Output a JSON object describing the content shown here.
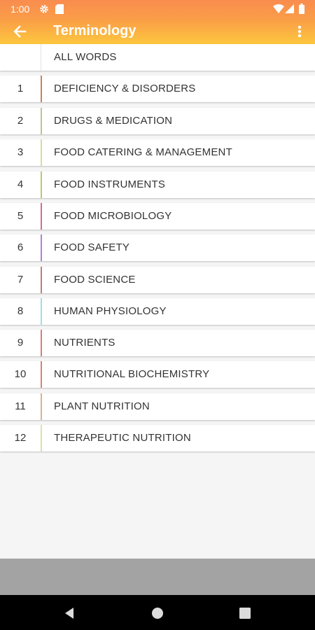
{
  "status_bar": {
    "time": "1:00",
    "icons": [
      "settings-icon",
      "sd-card-icon",
      "wifi-icon",
      "signal-icon",
      "battery-icon"
    ]
  },
  "toolbar": {
    "title": "Terminology",
    "back_icon": "arrow-back-icon",
    "menu_icon": "more-vert-icon"
  },
  "list": {
    "header_label": "ALL WORDS",
    "items": [
      {
        "num": "1",
        "label": "DEFICIENCY & DISORDERS",
        "color": "#c9825a"
      },
      {
        "num": "2",
        "label": "DRUGS & MEDICATION",
        "color": "#b5c98a"
      },
      {
        "num": "3",
        "label": "FOOD CATERING & MANAGEMENT",
        "color": "#d6dc9a"
      },
      {
        "num": "4",
        "label": "FOOD INSTRUMENTS",
        "color": "#b9c86b"
      },
      {
        "num": "5",
        "label": "FOOD MICROBIOLOGY",
        "color": "#d96a85"
      },
      {
        "num": "6",
        "label": "FOOD SAFETY",
        "color": "#b07fd6"
      },
      {
        "num": "7",
        "label": "FOOD SCIENCE",
        "color": "#c57a7a"
      },
      {
        "num": "8",
        "label": "HUMAN PHYSIOLOGY",
        "color": "#9fdfe0"
      },
      {
        "num": "9",
        "label": "NUTRIENTS",
        "color": "#e07a7a"
      },
      {
        "num": "10",
        "label": "NUTRITIONAL BIOCHEMISTRY",
        "color": "#d9807a"
      },
      {
        "num": "11",
        "label": "PLANT NUTRITION",
        "color": "#e0b08a"
      },
      {
        "num": "12",
        "label": "THERAPEUTIC NUTRITION",
        "color": "#d8e4a0"
      }
    ]
  },
  "nav_bar": {
    "back_icon": "nav-back-icon",
    "home_icon": "nav-home-icon",
    "recents_icon": "nav-recents-icon"
  },
  "colors": {
    "appbar_top": "#f98c4f",
    "appbar_bottom": "#fdc73e",
    "list_background": "#f5f5f5",
    "bottom_area": "#a3a3a3",
    "nav_bar": "#000000"
  }
}
